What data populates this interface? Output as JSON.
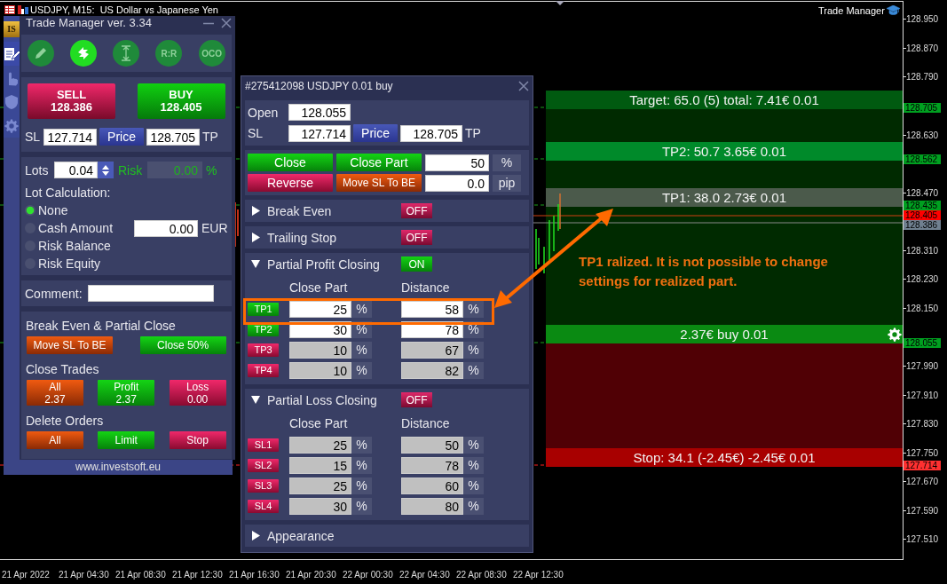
{
  "chart": {
    "title": "USDJPY, M15:  US Dollar vs Japanese Yen",
    "indicator": "Trade Manager",
    "price_axis": [
      {
        "text": "128.950"
      },
      {
        "text": "128.870"
      },
      {
        "text": "128.790"
      },
      {
        "text": "128.705",
        "color": "#00a020"
      },
      {
        "text": "128.630"
      },
      {
        "text": "128.562",
        "color": "#00a020"
      },
      {
        "text": "128.470"
      },
      {
        "text": "128.435",
        "color": "#00a020"
      },
      {
        "text": "128.405",
        "color": "#ff0000"
      },
      {
        "text": "128.386",
        "color": "#708090"
      },
      {
        "text": "128.310"
      },
      {
        "text": "128.230"
      },
      {
        "text": "128.150"
      },
      {
        "text": "128.055",
        "color": "#00a020"
      },
      {
        "text": "127.990"
      },
      {
        "text": "127.910"
      },
      {
        "text": "127.830"
      },
      {
        "text": "127.750"
      },
      {
        "text": "127.714",
        "color": "#ff3030"
      },
      {
        "text": "127.670"
      },
      {
        "text": "127.590"
      },
      {
        "text": "127.510"
      }
    ],
    "time_axis": [
      "21 Apr 2022",
      "21 Apr 04:30",
      "21 Apr 08:30",
      "21 Apr 12:30",
      "21 Apr 16:30",
      "21 Apr 20:30",
      "22 Apr 00:30",
      "22 Apr 04:30",
      "22 Apr 08:30",
      "22 Apr 12:30"
    ],
    "zones": [
      {
        "kind": "target",
        "label": "Target: 65.0 (5) total: 7.41€ 0.01"
      },
      {
        "kind": "tp",
        "label": "TP2: 50.7 3.65€ 0.01"
      },
      {
        "kind": "realized",
        "label": "TP1: 38.0 2.73€ 0.01"
      },
      {
        "kind": "entry",
        "label": "2.37€ buy 0.01"
      },
      {
        "kind": "stop",
        "label": "Stop: 34.1 (-2.45€) -2.45€ 0.01"
      }
    ],
    "note": "TP1 ralized. It is not possible to change\nsettings for realized part."
  },
  "trade_manager": {
    "title": "Trade Manager ver. 3.34",
    "logo": "IS",
    "sidebar": [
      {
        "kind": "edit",
        "selected": true
      },
      {
        "kind": "hand",
        "selected": false
      },
      {
        "kind": "shield",
        "selected": false
      },
      {
        "kind": "gear",
        "selected": false
      }
    ],
    "tools": [
      {
        "kind": "pencil",
        "selected": false
      },
      {
        "kind": "swap",
        "selected": true
      },
      {
        "kind": "range",
        "selected": false
      },
      {
        "kind": "text",
        "label": "R:R",
        "selected": false
      },
      {
        "kind": "text",
        "label": "OCO",
        "selected": false
      }
    ],
    "sell": {
      "label": "SELL",
      "price": "128.386"
    },
    "buy": {
      "label": "BUY",
      "price": "128.405"
    },
    "sl_label": "SL",
    "sl": "127.714",
    "price_button": "Price",
    "tp": "128.705",
    "tp_label": "TP",
    "lots_label": "Lots",
    "lots": "0.04",
    "risk_label": "Risk",
    "risk": {
      "value": "0.00",
      "disabled": true
    },
    "risk_unit": "%",
    "lot_calc_label": "Lot Calculation:",
    "lot_calc": [
      {
        "label": "None",
        "selected": true
      },
      {
        "label": "Cash Amount",
        "selected": false,
        "value": "0.00",
        "unit": "EUR"
      },
      {
        "label": "Risk Balance",
        "selected": false
      },
      {
        "label": "Risk Equity",
        "selected": false
      }
    ],
    "comment_label": "Comment:",
    "groups": [
      {
        "title": "Break Even & Partial Close",
        "buttons": [
          {
            "kind": "orange",
            "label": "Move SL To BE"
          },
          {
            "kind": "green",
            "label": "Close 50%"
          }
        ]
      },
      {
        "title": "Close Trades",
        "buttons": [
          {
            "kind": "orange",
            "label": "All",
            "value": "2.37"
          },
          {
            "kind": "green",
            "label": "Profit",
            "value": "2.37"
          },
          {
            "kind": "red",
            "label": "Loss",
            "value": "0.00"
          }
        ]
      },
      {
        "title": "Delete Orders",
        "buttons": [
          {
            "kind": "orange",
            "label": "All"
          },
          {
            "kind": "green",
            "label": "Limit"
          },
          {
            "kind": "red",
            "label": "Stop"
          }
        ]
      }
    ],
    "footer": "www.investsoft.eu"
  },
  "order": {
    "title": "#275412098 USDJPY 0.01 buy",
    "open_label": "Open",
    "open": "128.055",
    "sl_label": "SL",
    "sl": "127.714",
    "price_button": "Price",
    "tp": "128.705",
    "tp_label": "TP",
    "actions": [
      {
        "buttons": [
          {
            "kind": "green",
            "label": "Close"
          },
          {
            "kind": "green",
            "label": "Close Part"
          }
        ],
        "value": "50",
        "unit": "%"
      },
      {
        "buttons": [
          {
            "kind": "red",
            "label": "Reverse"
          },
          {
            "kind": "orange",
            "label": "Move SL To BE"
          }
        ],
        "value": "0.0",
        "unit": "pip"
      }
    ],
    "sections": [
      {
        "title": "Break Even",
        "expanded": false,
        "toggle": {
          "on": false,
          "label": "OFF"
        }
      },
      {
        "title": "Trailing Stop",
        "expanded": false,
        "toggle": {
          "on": false,
          "label": "OFF"
        }
      },
      {
        "title": "Partial Profit Closing",
        "expanded": true,
        "toggle": {
          "on": true,
          "label": "ON"
        },
        "columns": [
          "Close Part",
          "Distance"
        ],
        "rows": [
          {
            "label": "TP1",
            "enabled": true,
            "part": "25",
            "part_unit": "%",
            "distance": "58",
            "distance_unit": "%"
          },
          {
            "label": "TP2",
            "enabled": true,
            "part": "30",
            "part_unit": "%",
            "distance": "78",
            "distance_unit": "%"
          },
          {
            "label": "TP3",
            "enabled": false,
            "part": "10",
            "part_unit": "%",
            "distance": "67",
            "distance_unit": "%"
          },
          {
            "label": "TP4",
            "enabled": false,
            "part": "10",
            "part_unit": "%",
            "distance": "82",
            "distance_unit": "%"
          }
        ]
      },
      {
        "title": "Partial Loss Closing",
        "expanded": true,
        "toggle": {
          "on": false,
          "label": "OFF"
        },
        "columns": [
          "Close Part",
          "Distance"
        ],
        "rows": [
          {
            "label": "SL1",
            "enabled": false,
            "part": "25",
            "part_unit": "%",
            "distance": "50",
            "distance_unit": "%"
          },
          {
            "label": "SL2",
            "enabled": false,
            "part": "15",
            "part_unit": "%",
            "distance": "78",
            "distance_unit": "%"
          },
          {
            "label": "SL3",
            "enabled": false,
            "part": "25",
            "part_unit": "%",
            "distance": "60",
            "distance_unit": "%"
          },
          {
            "label": "SL4",
            "enabled": false,
            "part": "30",
            "part_unit": "%",
            "distance": "80",
            "distance_unit": "%"
          }
        ]
      },
      {
        "title": "Appearance",
        "expanded": false
      }
    ]
  }
}
